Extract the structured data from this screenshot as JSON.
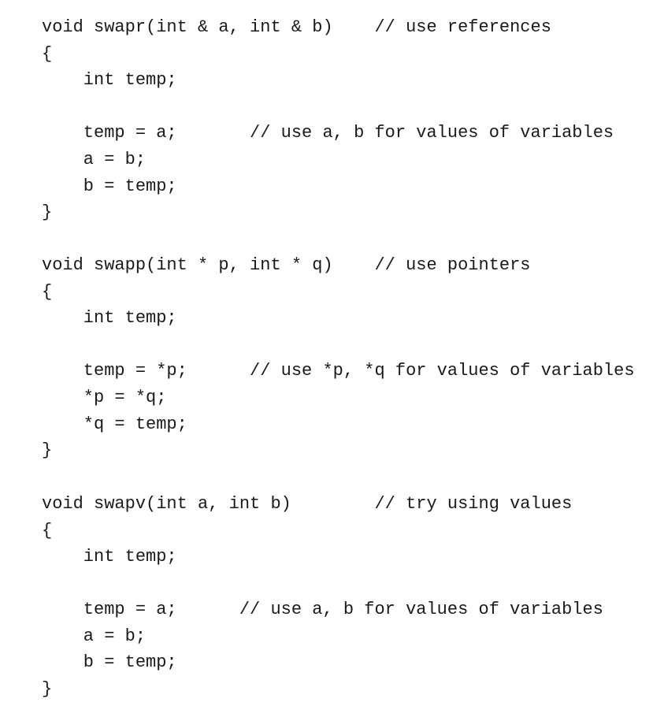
{
  "code": {
    "swapr": {
      "signature": "void swapr(int & a, int & b)    // use references",
      "open_brace": "{",
      "decl": "    int temp;",
      "assign_temp": "    temp = a;       // use a, b for values of variables",
      "assign_a": "    a = b;",
      "assign_b": "    b = temp;",
      "close_brace": "}"
    },
    "swapp": {
      "signature": "void swapp(int * p, int * q)    // use pointers",
      "open_brace": "{",
      "decl": "    int temp;",
      "assign_temp": "    temp = *p;      // use *p, *q for values of variables",
      "assign_p": "    *p = *q;",
      "assign_q": "    *q = temp;",
      "close_brace": "}"
    },
    "swapv": {
      "signature": "void swapv(int a, int b)        // try using values",
      "open_brace": "{",
      "decl": "    int temp;",
      "assign_temp": "    temp = a;      // use a, b for values of variables",
      "assign_a": "    a = b;",
      "assign_b": "    b = temp;",
      "close_brace": "}"
    }
  }
}
